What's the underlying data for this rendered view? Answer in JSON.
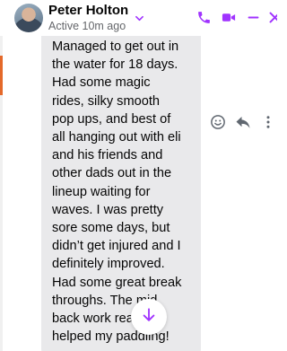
{
  "header": {
    "name": "Peter Holton",
    "status": "Active 10m ago"
  },
  "message": {
    "text": "Managed to get out in\nthe water for 18 days.\nHad some magic\nrides, silky smooth\npop ups, and best of\nall hanging out with eli\nand his friends and\nother dads out in the\nlineup waiting for\nwaves.    I was pretty\nsore some days, but\ndidn’t get injured and I\ndefinitely improved.\nHad some great break\nthroughs.      The mid\nback work really\nhelped my paddling!"
  },
  "icons": {
    "accent_color": "#a033ff",
    "header_buttons": [
      "phone-icon",
      "video-icon",
      "minimize-icon",
      "close-icon"
    ],
    "message_actions": [
      "react-icon",
      "reply-icon",
      "more-icon"
    ],
    "scroll_button": "arrow-down-icon"
  }
}
